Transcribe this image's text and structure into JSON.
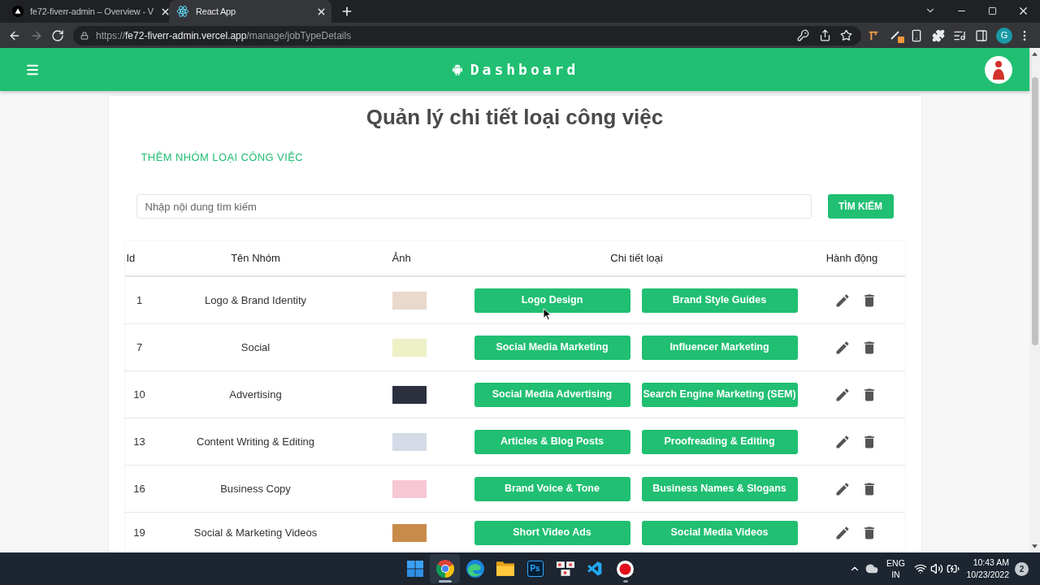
{
  "browser": {
    "tabs": [
      {
        "kind": "triangle",
        "title": "fe72-fiverr-admin – Overview - V",
        "selected": false
      },
      {
        "kind": "atom",
        "title": "React App",
        "selected": true
      }
    ],
    "nav": {
      "back_disabled": false,
      "forward_disabled": true
    },
    "address": {
      "scheme": "https://",
      "host": "fe72-fiverr-admin.vercel.app",
      "path": "/manage/jobTypeDetails"
    },
    "profile": {
      "initial": "G"
    }
  },
  "app_bar": {
    "title": "Dashboard"
  },
  "page": {
    "title": "Quản lý chi tiết loại công việc",
    "add_button": "THÊM NHÓM LOẠI CÔNG VIỆC",
    "search": {
      "placeholder": "Nhập nội dung tìm kiếm"
    },
    "search_button": "TÌM KIẾM"
  },
  "table": {
    "columns": [
      "Id",
      "Tên Nhóm",
      "Ảnh",
      "Chi tiết loại",
      "Hành động"
    ],
    "rows": [
      {
        "id": "1",
        "name": "Logo & Brand Identity",
        "details": [
          "Logo Design",
          "Brand Style Guides"
        ]
      },
      {
        "id": "7",
        "name": "Social",
        "details": [
          "Social Media Marketing",
          "Influencer Marketing"
        ]
      },
      {
        "id": "10",
        "name": "Advertising",
        "details": [
          "Social Media Advertising",
          "Search Engine Marketing (SEM)"
        ]
      },
      {
        "id": "13",
        "name": "Content Writing & Editing",
        "details": [
          "Articles & Blog Posts",
          "Proofreading & Editing"
        ]
      },
      {
        "id": "16",
        "name": "Business Copy",
        "details": [
          "Brand Voice & Tone",
          "Business Names & Slogans"
        ]
      },
      {
        "id": "19",
        "name": "Social & Marketing Videos",
        "details": [
          "Short Video Ads",
          "Social Media Videos"
        ]
      }
    ]
  },
  "taskbar": {
    "apps": [
      {
        "kind": "start",
        "open": false,
        "selected": false
      },
      {
        "kind": "browser",
        "open": true,
        "selected": true
      },
      {
        "kind": "swirl",
        "open": false,
        "selected": false
      },
      {
        "kind": "folder",
        "open": false,
        "selected": false
      },
      {
        "kind": "ps",
        "label": "Ps",
        "open": false,
        "selected": false
      },
      {
        "kind": "tiles",
        "open": false,
        "selected": false
      },
      {
        "kind": "editor",
        "open": false,
        "selected": false
      },
      {
        "kind": "record",
        "open": true,
        "selected": false
      }
    ],
    "language": [
      "ENG",
      "IN"
    ],
    "time": "10:43 AM",
    "date": "10/23/2022",
    "notifications": "2"
  }
}
